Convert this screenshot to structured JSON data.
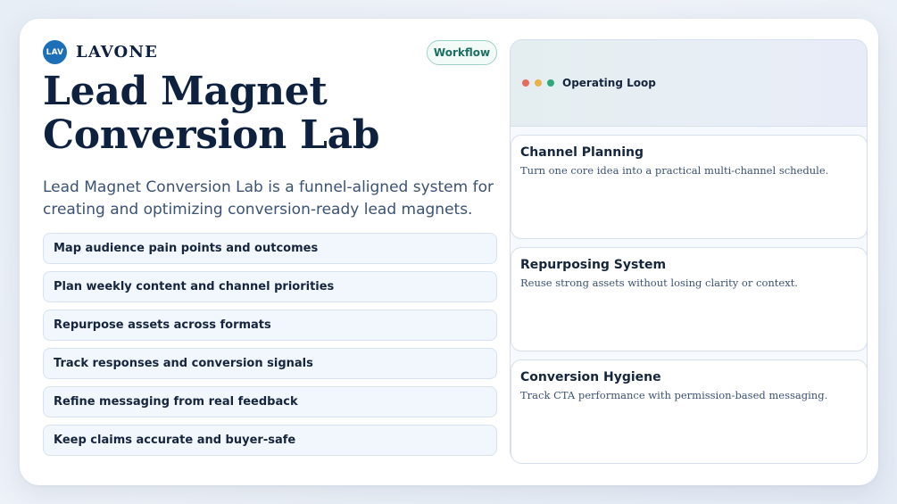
{
  "brand": {
    "logo_text": "LAV",
    "name": "LAVONE"
  },
  "badge": {
    "label": "Workflow"
  },
  "hero": {
    "title": "Lead Magnet Conversion Lab",
    "subtitle": "Lead Magnet Conversion Lab is a funnel-aligned system for creating and optimizing conversion-ready lead magnets."
  },
  "checklist": [
    {
      "label": "Map audience pain points and outcomes"
    },
    {
      "label": "Plan weekly content and channel priorities"
    },
    {
      "label": "Repurpose assets across formats"
    },
    {
      "label": "Track responses and conversion signals"
    },
    {
      "label": "Refine messaging from real feedback"
    },
    {
      "label": "Keep claims accurate and buyer-safe"
    }
  ],
  "panel": {
    "title": "Operating Loop",
    "window_dots": [
      "#e76a5d",
      "#e9b24a",
      "#2fa87a"
    ],
    "cards": [
      {
        "title": "Channel Planning",
        "description": "Turn one core idea into a practical multi-channel schedule."
      },
      {
        "title": "Repurposing System",
        "description": "Reuse strong assets without losing clarity or context."
      },
      {
        "title": "Conversion Hygiene",
        "description": "Track CTA performance with permission-based messaging."
      }
    ]
  },
  "colors": {
    "brand": "#1d6fb8",
    "heading": "#0e2240",
    "accent_teal": "#1b6f63"
  }
}
